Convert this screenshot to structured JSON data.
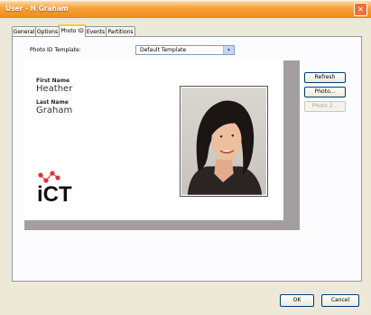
{
  "window": {
    "title": "User - H Graham",
    "close_glyph": "✕"
  },
  "tabs": [
    {
      "label": "General"
    },
    {
      "label": "Options"
    },
    {
      "label": "Photo ID"
    },
    {
      "label": "Events"
    },
    {
      "label": "Partitions"
    }
  ],
  "photo_id": {
    "template_label": "Photo ID Template:",
    "template_value": "Default Template",
    "dropdown_glyph": "▾",
    "card": {
      "first_name_label": "First Name",
      "first_name": "Heather",
      "last_name_label": "Last Name",
      "last_name": "Graham",
      "logo_text": "iCT",
      "logo_color": "#e5312e",
      "logo_text_color": "#111111"
    },
    "buttons": {
      "refresh": "Refresh",
      "photo": "Photo...",
      "photo2": "Photo 2..."
    }
  },
  "footer": {
    "ok": "OK",
    "cancel": "Cancel"
  }
}
